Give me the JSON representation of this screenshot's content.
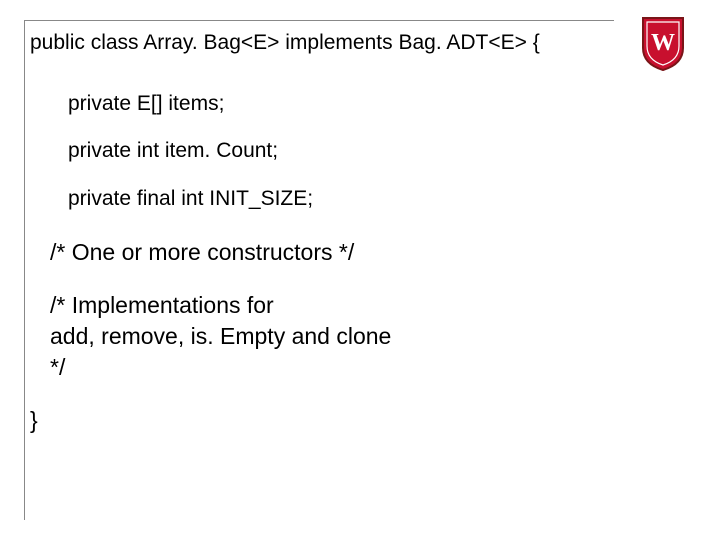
{
  "code": {
    "decl_prefix": "public class Array. Bag<",
    "decl_e1": "E",
    "decl_mid": "> implements Bag. ADT<",
    "decl_e2": "E",
    "decl_suffix": "> {",
    "field1_prefix": "private ",
    "field1_type": "E",
    "field1_suffix": "[] items;",
    "field2": "private int item. Count;",
    "field3": "private final int INIT_SIZE;",
    "comment1": "/* One or more constructors  */",
    "comment2_l1": "/* Implementations for",
    "comment2_l2": "    add, remove, is. Empty and clone",
    "comment2_l3": "*/",
    "close": "}"
  },
  "logo": {
    "letter": "W",
    "outer_color": "#8a1c1c",
    "inner_color": "#c8102e",
    "letter_color": "#ffffff"
  }
}
